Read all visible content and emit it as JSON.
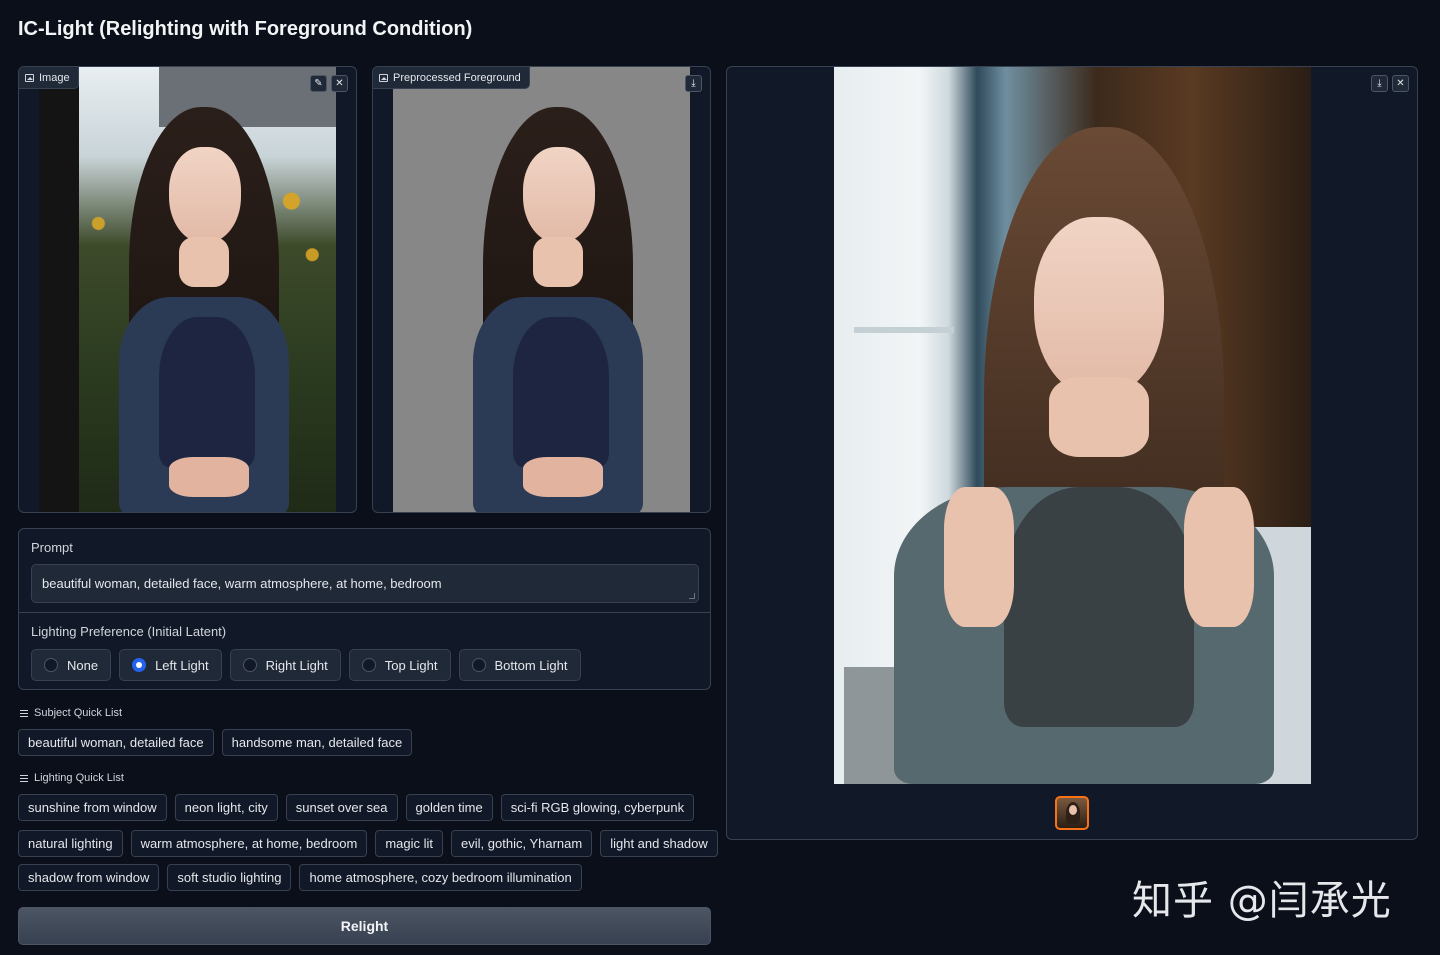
{
  "app_title": "IC-Light (Relighting with Foreground Condition)",
  "input_image": {
    "label": "Image",
    "edit_icon": "pencil-icon",
    "clear_icon": "close-icon"
  },
  "preprocessed": {
    "label": "Preprocessed Foreground",
    "download_icon": "download-icon"
  },
  "output_gallery": {
    "download_icon": "download-icon",
    "close_icon": "close-icon",
    "selected_thumb_color": "#f97316"
  },
  "prompt": {
    "label": "Prompt",
    "value": "beautiful woman, detailed face, warm atmosphere, at home, bedroom"
  },
  "lighting_preference": {
    "label": "Lighting Preference (Initial Latent)",
    "options": [
      "None",
      "Left Light",
      "Right Light",
      "Top Light",
      "Bottom Light"
    ],
    "selected": "Left Light"
  },
  "subject_quick_list": {
    "label": "Subject Quick List",
    "items": [
      "beautiful woman, detailed face",
      "handsome man, detailed face"
    ]
  },
  "lighting_quick_list": {
    "label": "Lighting Quick List",
    "rows": [
      [
        "sunshine from window",
        "neon light, city",
        "sunset over sea",
        "golden time",
        "sci-fi RGB glowing, cyberpunk"
      ],
      [
        "natural lighting",
        "warm atmosphere, at home, bedroom",
        "magic lit",
        "evil, gothic, Yharnam",
        "light and shadow"
      ],
      [
        "shadow from window",
        "soft studio lighting",
        "home atmosphere, cozy bedroom illumination"
      ]
    ]
  },
  "relight_button": "Relight",
  "watermark": "知乎 @闫承光",
  "colors": {
    "background": "#0b0f19",
    "panel": "#111827",
    "border": "#374151",
    "radio_accent": "#2563eb"
  }
}
